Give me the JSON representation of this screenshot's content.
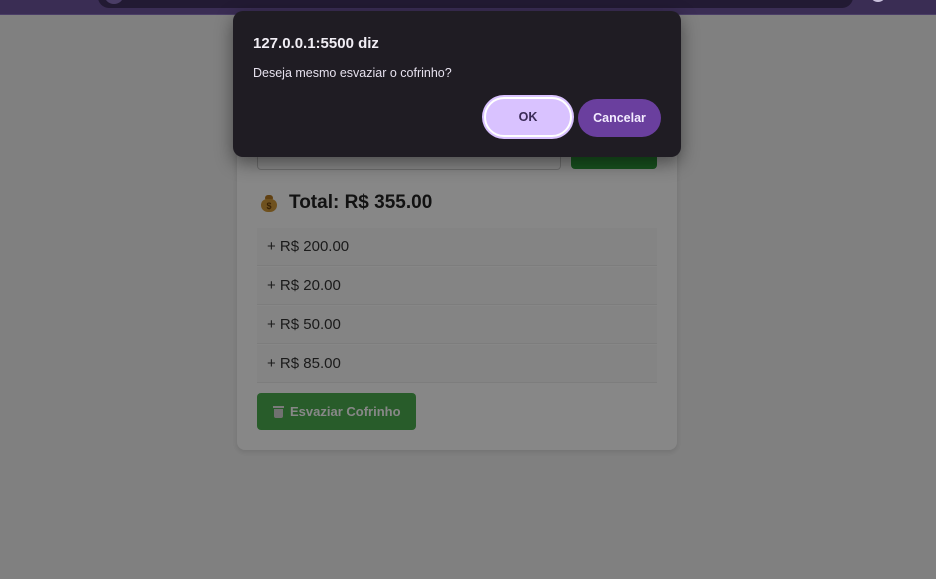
{
  "colors": {
    "browser_chrome": "#3a2d54",
    "dialog_background": "#1f1c23",
    "ok_button": "#d9c2ff",
    "cancel_button": "#6a3f9e",
    "empty_button": "#4caf50",
    "add_button": "#2e9e3c"
  },
  "piggy_bank": {
    "total_icon": "money-bag-icon",
    "total_label": "Total: R$ 355.00",
    "deposits": [
      "+ R$ 200.00",
      "+ R$ 20.00",
      "+ R$ 50.00",
      "+ R$ 85.00"
    ],
    "empty_button_icon": "trash-icon",
    "empty_button_label": "Esvaziar Cofrinho"
  },
  "dialog": {
    "title": "127.0.0.1:5500 diz",
    "message": "Deseja mesmo esvaziar o cofrinho?",
    "ok_label": "OK",
    "cancel_label": "Cancelar"
  }
}
